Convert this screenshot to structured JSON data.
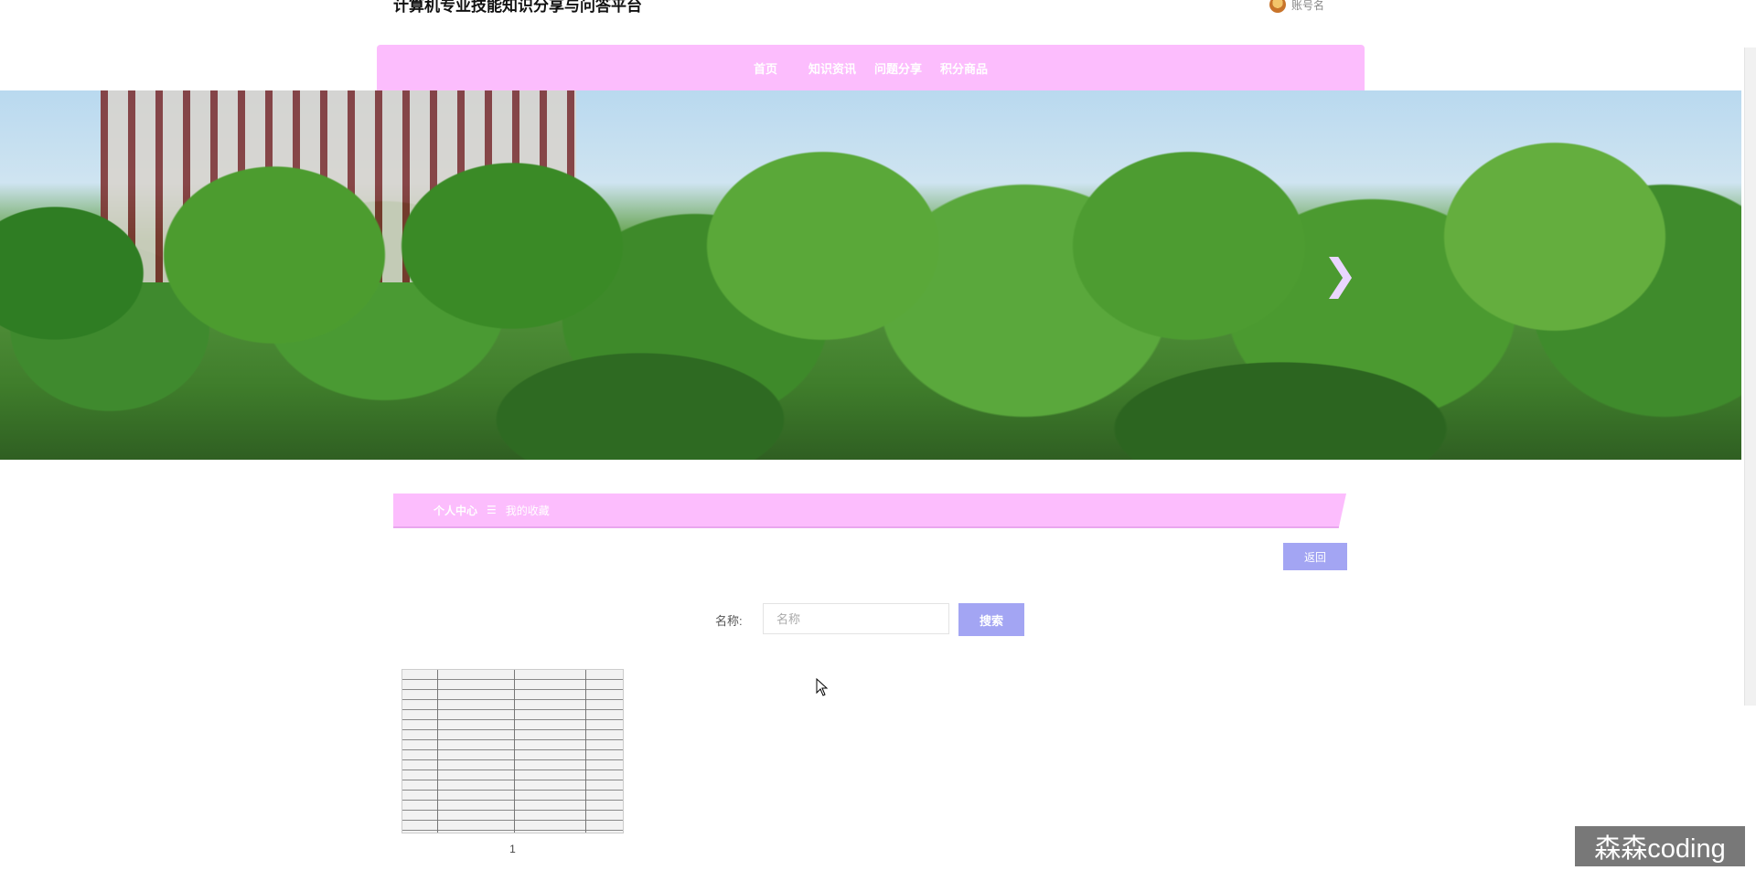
{
  "header": {
    "title": "计算机专业技能知识分享与问答平台",
    "account_label": "账号名"
  },
  "nav": {
    "items": [
      "首页",
      "知识资讯",
      "问题分享",
      "积分商品"
    ]
  },
  "banner": {
    "next_icon": "chevron-right-icon"
  },
  "breadcrumb": {
    "home": "个人中心",
    "separator": "☰",
    "current": "我的收藏"
  },
  "actions": {
    "back_label": "返回"
  },
  "search": {
    "label": "名称:",
    "placeholder": "名称",
    "button_label": "搜索"
  },
  "favorites": [
    {
      "caption": "1"
    }
  ],
  "watermark": "森森coding",
  "colors": {
    "nav_bg": "#fcbdfd",
    "button_bg": "#a3a5f3"
  }
}
